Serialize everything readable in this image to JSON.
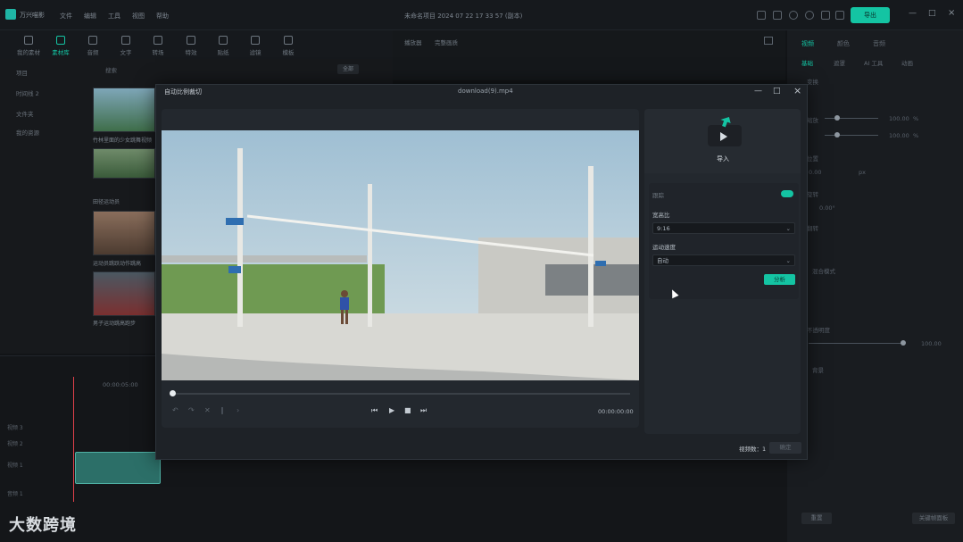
{
  "titlebar": {
    "app_name": "万兴喵影",
    "menus": [
      "文件",
      "编辑",
      "工具",
      "视图",
      "帮助"
    ],
    "project_title": "未命名项目 2024 07 22 17 33 57 (副本)",
    "export_label": "导出"
  },
  "toolbar": {
    "items": [
      {
        "label": "我的素材"
      },
      {
        "label": "素材库"
      },
      {
        "label": "音频"
      },
      {
        "label": "文字"
      },
      {
        "label": "转场"
      },
      {
        "label": "特效"
      },
      {
        "label": "贴纸"
      },
      {
        "label": "滤镜"
      },
      {
        "label": "模板"
      }
    ]
  },
  "preview_header": {
    "tab1": "播放器",
    "tab2": "完整画质"
  },
  "left_nav": {
    "items": [
      "项目",
      "时间线 2",
      "文件夹",
      "我的资源"
    ]
  },
  "media": {
    "search_placeholder": "搜索",
    "filter_label": "全部",
    "items": [
      {
        "caption": "竹林里面的少女跳舞视频"
      },
      {
        "caption": "田径运动员"
      },
      {
        "caption": "运动员跳跃动作跳高"
      },
      {
        "caption": "男子运动跳高跑步"
      }
    ]
  },
  "right_panel": {
    "tabs": [
      "视频",
      "颜色",
      "音频"
    ],
    "subtabs": [
      "基础",
      "遮罩",
      "AI 工具",
      "动画"
    ],
    "rows": [
      {
        "label": "变换"
      },
      {
        "label": "缩放",
        "value": "100.00",
        "unit": "%"
      },
      {
        "label": "",
        "value": "100.00",
        "unit": "%"
      },
      {
        "label": "位置",
        "value": "0.00",
        "unit": "px"
      },
      {
        "label": "旋转",
        "value": "0.00°"
      },
      {
        "label": "翻转"
      },
      {
        "label": "混合模式"
      },
      {
        "label": "不透明度",
        "value": "100.00"
      },
      {
        "label": "背景"
      }
    ],
    "reset_label": "重置",
    "keyframe_label": "关键帧面板"
  },
  "timeline": {
    "timecode": "00:00:05:00",
    "tracks": [
      "视频 3",
      "视频 2",
      "视频 1",
      "音频 1"
    ]
  },
  "dialog": {
    "title": "自动比例裁切",
    "filename": "download(9).mp4",
    "timecode": "00:00:00:00",
    "import_label": "导入",
    "settings_header": "跟踪",
    "aspect_label": "宽高比",
    "aspect_value": "9:16",
    "speed_label": "运动速度",
    "speed_value": "自动",
    "analyze_label": "分析",
    "count_label": "视频数：1",
    "ok_label": "确定"
  },
  "watermark": "大数跨境",
  "colors": {
    "accent": "#14c4a3",
    "playhead": "#e0404a"
  }
}
